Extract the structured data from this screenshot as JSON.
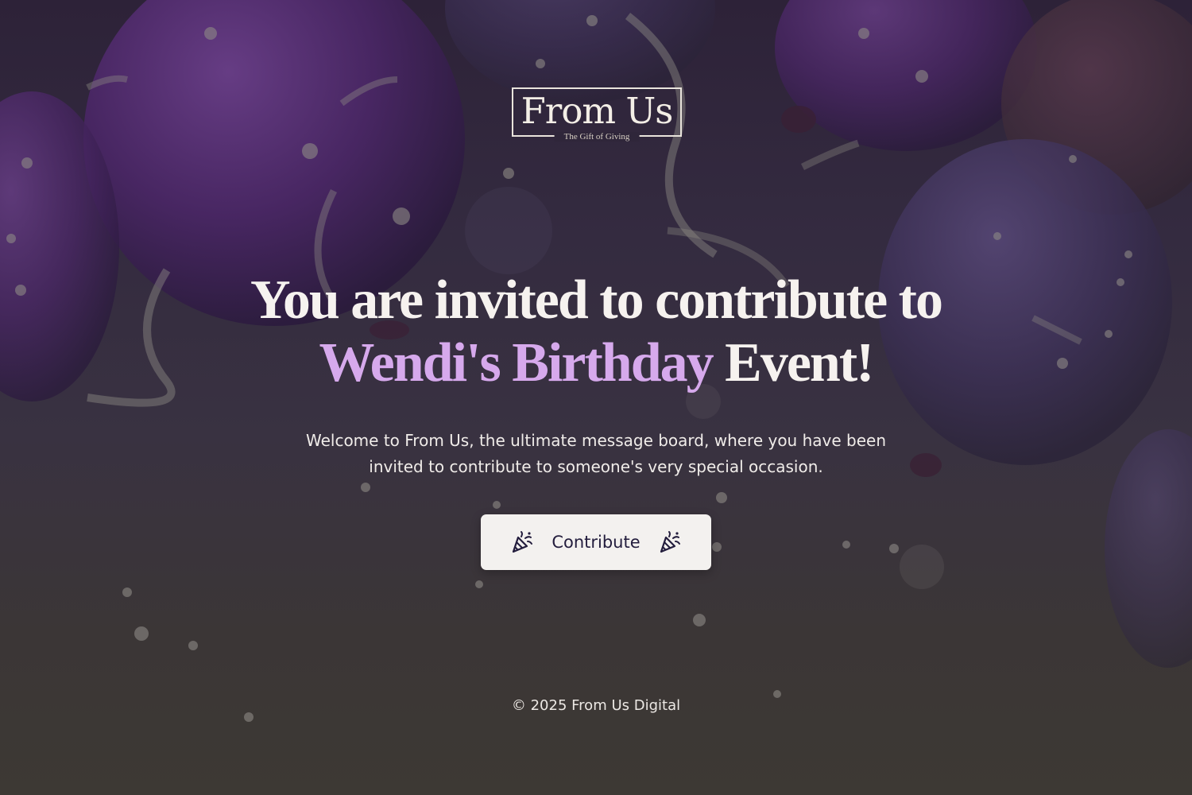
{
  "logo": {
    "title": "From Us",
    "subtitle": "The Gift of Giving"
  },
  "heading": {
    "line1": "You are invited to contribute to",
    "highlight": "Wendi's Birthday",
    "end": "Event!"
  },
  "welcome": {
    "line1": "Welcome to From Us, the ultimate message board, where you have been",
    "line2": "invited to contribute to someone's very special occasion."
  },
  "contribute_button": {
    "label": "Contribute",
    "icon": "party-popper-icon"
  },
  "footer": {
    "text": "© 2025 From Us Digital"
  },
  "colors": {
    "highlight": "#d6a9ec",
    "button_bg": "#f3f1ef",
    "button_text": "#231d3d"
  }
}
